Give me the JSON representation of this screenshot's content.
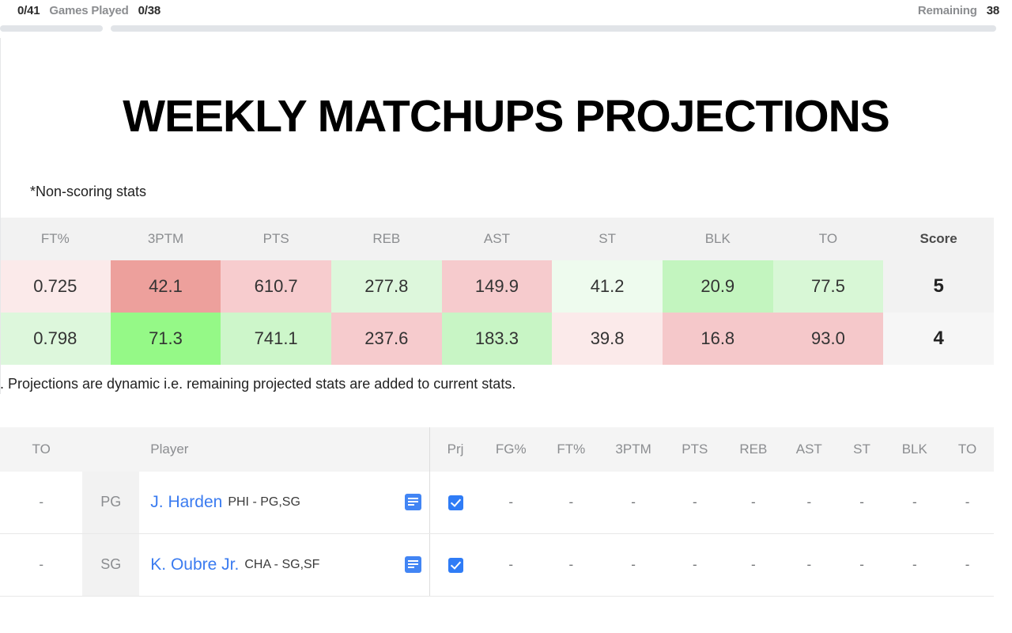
{
  "topbar": {
    "games_played_left": "0/41",
    "games_played_label": "Games Played",
    "games_played_right": "0/38",
    "remaining_label": "Remaining",
    "remaining_value": "38",
    "progress_left_pct": 0,
    "progress_right_pct": 0
  },
  "page": {
    "title": "WEEKLY MATCHUPS PROJECTIONS",
    "subnote": "*Non-scoring stats",
    "caption": "). Projections are dynamic i.e. remaining projected stats are added to current stats."
  },
  "projections": {
    "columns": [
      "FT%",
      "3PTM",
      "PTS",
      "REB",
      "AST",
      "ST",
      "BLK",
      "TO",
      "Score"
    ],
    "rows": [
      {
        "cells": [
          "0.725",
          "42.1",
          "610.7",
          "277.8",
          "149.9",
          "41.2",
          "20.9",
          "77.5"
        ],
        "score": "5",
        "colors": [
          "#fbeaea",
          "#eda09c",
          "#f7ccce",
          "#ddf7dc",
          "#f6cbcd",
          "#eefbee",
          "#c3f5bf",
          "#d8f7d6"
        ]
      },
      {
        "cells": [
          "0.798",
          "71.3",
          "741.1",
          "237.6",
          "183.3",
          "39.8",
          "16.8",
          "93.0"
        ],
        "score": "4",
        "colors": [
          "#ddf7dc",
          "#95f987",
          "#cdf6ca",
          "#f6cbcd",
          "#c8f5c5",
          "#fbeaea",
          "#f5c8ca",
          "#f5c8ca"
        ]
      }
    ]
  },
  "roster": {
    "columns": [
      "TO",
      "Player",
      "Prj",
      "FG%",
      "FT%",
      "3PTM",
      "PTS",
      "REB",
      "AST",
      "ST",
      "BLK",
      "TO"
    ],
    "rows": [
      {
        "to": "-",
        "slot": "PG",
        "player_name": "J. Harden",
        "player_team": "PHI - PG,SG",
        "note_icon": "note-icon",
        "checked": true,
        "stats": [
          "-",
          "-",
          "-",
          "-",
          "-",
          "-",
          "-",
          "-",
          "-"
        ]
      },
      {
        "to": "-",
        "slot": "SG",
        "player_name": "K. Oubre Jr.",
        "player_team": "CHA - SG,SF",
        "note_icon": "note-icon",
        "checked": true,
        "stats": [
          "-",
          "-",
          "-",
          "-",
          "-",
          "-",
          "-",
          "-",
          "-"
        ]
      }
    ]
  },
  "colors": {
    "accent_blue": "#3a7bf0",
    "checkbox_blue": "#2f7cf6",
    "header_gray": "#f2f2f2",
    "progress_track": "#e1e4e8"
  }
}
